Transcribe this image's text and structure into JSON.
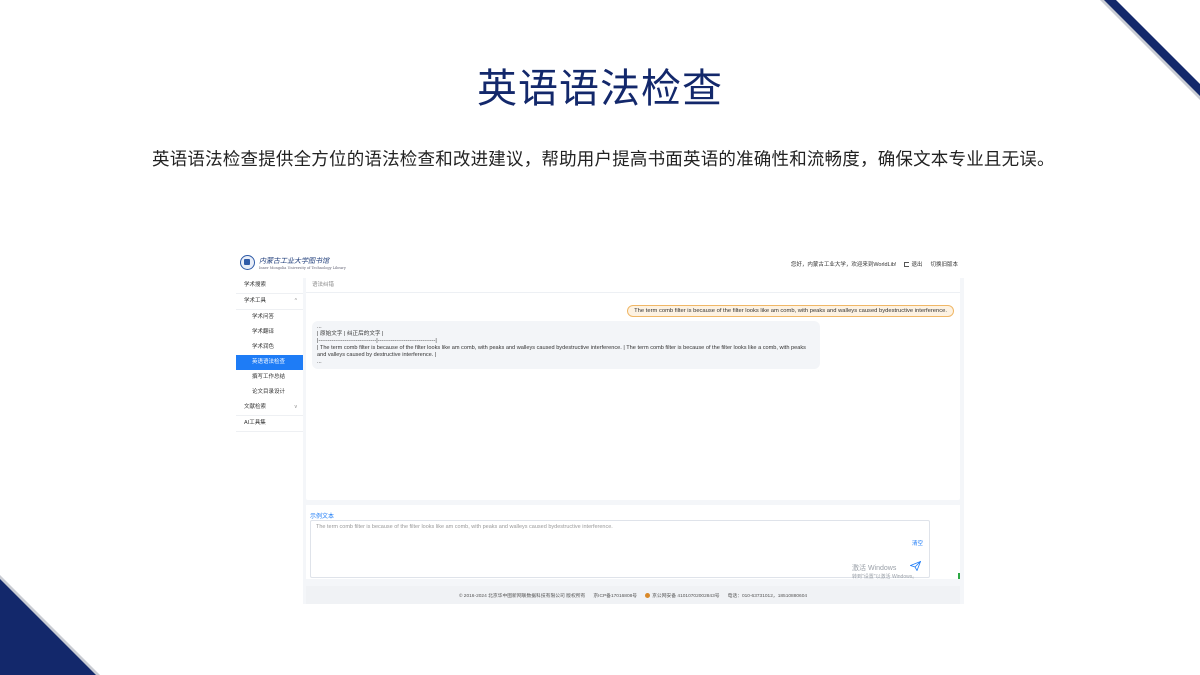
{
  "slide": {
    "title": "英语语法检查",
    "description": "英语语法检查提供全方位的语法检查和改进建议，帮助用户提高书面英语的准确性和流畅度，确保文本专业且无误。"
  },
  "app": {
    "logo": {
      "name": "内蒙古工业大学图书馆",
      "subtitle": "Inner Mongolia University of Technology Library"
    },
    "header": {
      "greeting": "您好，内蒙古工业大学，欢迎来到WorldLib!",
      "logout": "退出",
      "switch_version": "切换旧版本"
    },
    "sidebar": {
      "items": [
        {
          "label": "学术搜索",
          "level": 1
        },
        {
          "label": "学术工具",
          "level": 1,
          "chevron": "^"
        },
        {
          "label": "学术问答",
          "level": 2
        },
        {
          "label": "学术翻译",
          "level": 2
        },
        {
          "label": "学术润色",
          "level": 2
        },
        {
          "label": "英语语法检查",
          "level": 2,
          "active": true
        },
        {
          "label": "撰写工作总结",
          "level": 2
        },
        {
          "label": "论文目录设计",
          "level": 2
        },
        {
          "label": "文献检索",
          "level": 1,
          "chevron": "v"
        },
        {
          "label": "AI工具集",
          "level": 1
        }
      ]
    },
    "main": {
      "panel_label": "语法纠错",
      "user_message": "The term comb filter is because of the filter looks like am comb, with peaks and walleys caused bydestructive interference.",
      "bot_lines": [
        "...",
        "| 原始文字 | 纠正后的文字 |",
        "|-------------------------------|-------------------------------|",
        "| The term comb filter is because of the filter looks like am comb, with peaks and walleys caused bydestructive interference. | The term comb filter is because of the filter looks like a comb, with peaks and valleys caused by destructive interference. |",
        "..."
      ]
    },
    "input": {
      "label": "示例文本",
      "text": "The term comb filter is because of the filter looks like am comb, with peaks and walleys caused bydestructive interference.",
      "clear": "清空",
      "watermark_title": "激活 Windows",
      "watermark_sub": "转到\"设置\"以激活 Windows。"
    },
    "footer": {
      "copyright": "© 2016-2024 北京华中图新网联数据科技有限公司 版权所有",
      "icp": "京ICP备17016808号",
      "police": "京公网安备 41010702002843号",
      "phone": "电话：010-63731012，18510880604"
    },
    "colors": {
      "accent": "#1e7cf6",
      "navy": "#13286b",
      "bubble_border": "#f0b766"
    }
  }
}
